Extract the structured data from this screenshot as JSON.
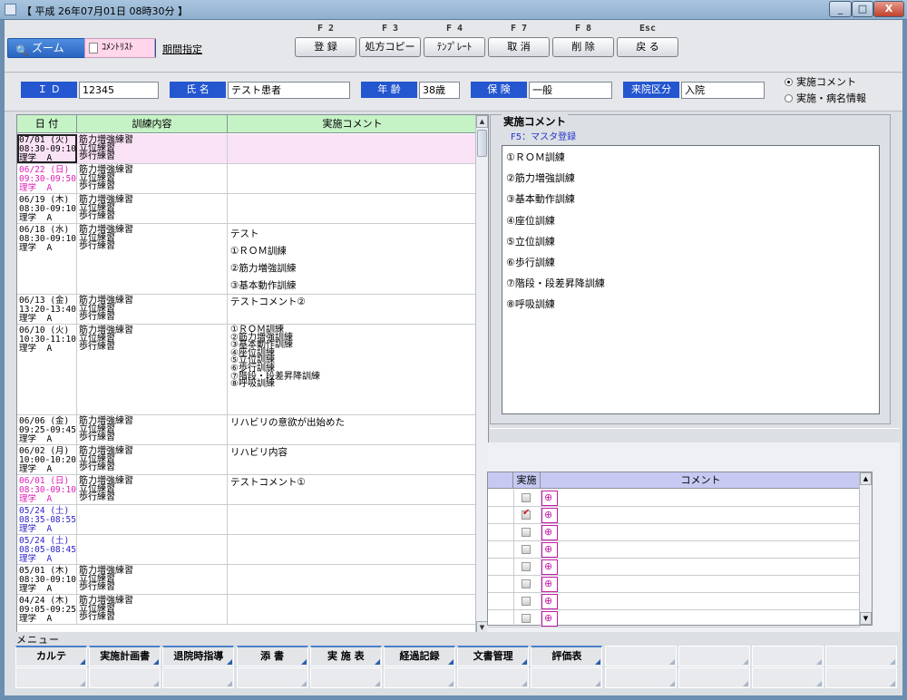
{
  "window": {
    "title": "【 平成 26年07月01日 08時30分 】",
    "controls": [
      "_",
      "□",
      "X"
    ]
  },
  "toolbar": {
    "zoom_label": "ズーム",
    "comment_list_label": "ｺﾒﾝﾄﾘｽﾄ",
    "period_label": "期間指定",
    "keys": [
      {
        "key": "F 2",
        "label": "登 録"
      },
      {
        "key": "F 3",
        "label": "処方コピー"
      },
      {
        "key": "F 4",
        "label": "ﾃﾝﾌﾟﾚｰﾄ"
      },
      {
        "key": "F 7",
        "label": "取 消"
      },
      {
        "key": "F 8",
        "label": "削 除"
      },
      {
        "key": "Esc",
        "label": "戻 る"
      }
    ]
  },
  "patient": {
    "id_label": "Ｉ Ｄ",
    "id": "12345",
    "name_label": "氏 名",
    "name": "テスト患者",
    "age_label": "年 齢",
    "age": "38歳",
    "insurance_label": "保 険",
    "insurance": "一般",
    "visit_label": "来院区分",
    "visit": "入院",
    "radio_options": [
      {
        "label": "実施コメント",
        "selected": true
      },
      {
        "label": "実施・病名情報",
        "selected": false
      }
    ]
  },
  "history": {
    "headers": [
      "日 付",
      "訓練内容",
      "実施コメント"
    ],
    "rows": [
      {
        "date": "07/01 (火)",
        "time": "08:30-09:10",
        "staff": "理学  A",
        "training": [
          "筋力増強練習",
          "立位練習",
          "歩行練習"
        ],
        "comment": [],
        "color": "black"
      },
      {
        "date": "06/22 (日)",
        "time": "09:30-09:50",
        "staff": "理学  A",
        "training": [
          "筋力増強練習",
          "立位練習",
          "歩行練習"
        ],
        "comment": [],
        "color": "magenta"
      },
      {
        "date": "06/19 (木)",
        "time": "08:30-09:10",
        "staff": "理学  A",
        "training": [
          "筋力増強練習",
          "立位練習",
          "歩行練習"
        ],
        "comment": [],
        "color": "black"
      },
      {
        "date": "06/18 (水)",
        "time": "08:30-09:10",
        "staff": "理学  A",
        "training": [
          "筋力増強練習",
          "立位練習",
          "歩行練習"
        ],
        "comment": [
          "テスト",
          "①ＲＯＭ訓練",
          "②筋力増強訓練",
          "③基本動作訓練"
        ],
        "color": "black"
      },
      {
        "date": "06/13 (金)",
        "time": "13:20-13:40",
        "staff": "理学  A",
        "training": [
          "筋力増強練習",
          "立位練習",
          "歩行練習"
        ],
        "comment": [
          "テストコメント②"
        ],
        "color": "black"
      },
      {
        "date": "06/10 (火)",
        "time": "10:30-11:10",
        "staff": "理学  A",
        "training": [
          "筋力増強練習",
          "立位練習",
          "歩行練習"
        ],
        "comment": [
          "①ＲＯＭ訓練",
          "②筋力増強訓練",
          "③基本動作訓練",
          "④座位訓練",
          "⑤立位訓練",
          "⑥歩行訓練",
          "⑦階段・段差昇降訓練",
          "⑧呼吸訓練"
        ],
        "color": "black"
      },
      {
        "date": "06/06 (金)",
        "time": "09:25-09:45",
        "staff": "理学  A",
        "training": [
          "筋力増強練習",
          "立位練習",
          "歩行練習"
        ],
        "comment": [
          "リハビリの意欲が出始めた"
        ],
        "color": "black"
      },
      {
        "date": "06/02 (月)",
        "time": "10:00-10:20",
        "staff": "理学  A",
        "training": [
          "筋力増強練習",
          "立位練習",
          "歩行練習"
        ],
        "comment": [
          "リハビリ内容"
        ],
        "color": "black"
      },
      {
        "date": "06/01 (日)",
        "time": "08:30-09:10",
        "staff": "理学  A",
        "training": [
          "筋力増強練習",
          "立位練習",
          "歩行練習"
        ],
        "comment": [
          "テストコメント①"
        ],
        "color": "magenta"
      },
      {
        "date": "05/24 (土)",
        "time": "08:35-08:55",
        "staff": "理学  A",
        "training": [],
        "comment": [],
        "color": "blue"
      },
      {
        "date": "05/24 (土)",
        "time": "08:05-08:45",
        "staff": "理学  A",
        "training": [],
        "comment": [],
        "color": "blue"
      },
      {
        "date": "05/01 (木)",
        "time": "08:30-09:10",
        "staff": "理学  A",
        "training": [
          "筋力増強練習",
          "立位練習",
          "歩行練習"
        ],
        "comment": [],
        "color": "black"
      },
      {
        "date": "04/24 (木)",
        "time": "09:05-09:25",
        "staff": "理学  A",
        "training": [
          "筋力増強練習",
          "立位練習",
          "歩行練習"
        ],
        "comment": [],
        "color": "black"
      }
    ]
  },
  "comment_panel": {
    "title": "実施コメント",
    "f5_label": "F5：マスタ登録",
    "items": [
      "①ＲＯＭ訓練",
      "②筋力増強訓練",
      "③基本動作訓練",
      "④座位訓練",
      "⑤立位訓練",
      "⑥歩行訓練",
      "⑦階段・段差昇降訓練",
      "⑧呼吸訓練"
    ]
  },
  "check_table": {
    "headers": [
      "実施",
      "コメント"
    ],
    "checked": [
      false,
      true,
      false,
      false,
      false,
      false,
      false,
      false
    ]
  },
  "menu": {
    "label": "メニュー",
    "buttons": [
      "カルテ",
      "実施計画書",
      "退院時指導",
      "添 書",
      "実 施 表",
      "経過記録",
      "文書管理",
      "評価表"
    ]
  }
}
